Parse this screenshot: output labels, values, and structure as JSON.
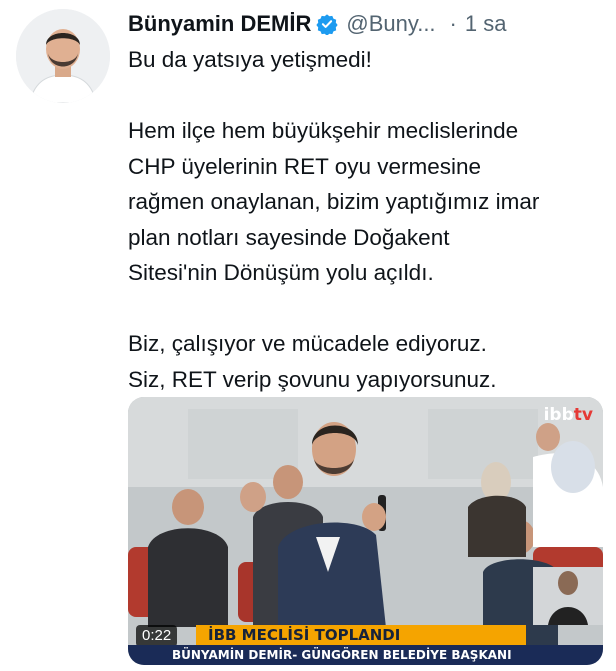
{
  "author": {
    "name": "Bünyamin DEMİR",
    "handle": "@Buny...",
    "separator": "·",
    "time": "1 sa",
    "verified_color": "#1d9bf0"
  },
  "tweet": {
    "lines_p1": [
      "Bu da yatsıya yetişmedi!"
    ],
    "lines_p2": [
      "Hem ilçe hem büyükşehir meclislerinde",
      "CHP üyelerinin RET oyu vermesine",
      "rağmen onaylanan, bizim yaptığımız imar",
      "plan notları sayesinde Doğakent",
      "Sitesi'nin Dönüşüm yolu açıldı."
    ],
    "lines_p3": [
      "Biz, çalışıyor ve mücadele ediyoruz.",
      "Siz, RET verip şovunu yapıyorsunuz."
    ]
  },
  "media": {
    "duration": "0:22",
    "logo_main": "ibb",
    "logo_accent": "tv",
    "lower_third_headline": "İBB MECLİSİ TOPLANDI",
    "lower_third_caption": "BÜNYAMİN DEMİR- GÜNGÖREN BELEDİYE BAŞKANI",
    "headline_color": "#f5a400",
    "caption_color": "#1a2b57"
  }
}
